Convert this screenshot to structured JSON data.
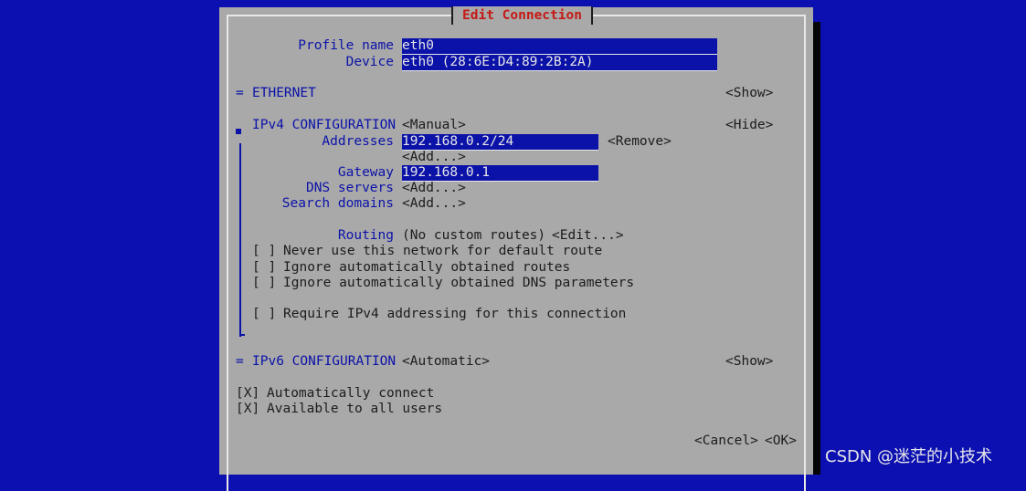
{
  "dialog": {
    "title": "Edit Connection",
    "profile_name_label": "Profile name",
    "profile_name_value": "eth0",
    "device_label": "Device",
    "device_value": "eth0 (28:6E:D4:89:2B:2A)"
  },
  "ethernet": {
    "marker": "=",
    "label": "ETHERNET",
    "toggle": "<Show>"
  },
  "ipv4": {
    "label": "IPv4 CONFIGURATION",
    "mode": "<Manual>",
    "toggle": "<Hide>",
    "addresses_label": "Addresses",
    "address_value": "192.168.0.2/24",
    "remove_button": "<Remove>",
    "add_address_button": "<Add...>",
    "gateway_label": "Gateway",
    "gateway_value": "192.168.0.1",
    "dns_label": "DNS servers",
    "dns_add_button": "<Add...>",
    "search_label": "Search domains",
    "search_add_button": "<Add...>",
    "routing_label": "Routing",
    "routing_value": "(No custom routes)",
    "routing_edit_button": "<Edit...>",
    "checkboxes": [
      {
        "box": "[ ]",
        "label": "Never use this network for default route"
      },
      {
        "box": "[ ]",
        "label": "Ignore automatically obtained routes"
      },
      {
        "box": "[ ]",
        "label": "Ignore automatically obtained DNS parameters"
      },
      {
        "box": "[ ]",
        "label": "Require IPv4 addressing for this connection"
      }
    ]
  },
  "ipv6": {
    "marker": "=",
    "label": "IPv6 CONFIGURATION",
    "mode": "<Automatic>",
    "toggle": "<Show>"
  },
  "options": [
    {
      "box": "[X]",
      "label": "Automatically connect"
    },
    {
      "box": "[X]",
      "label": "Available to all users"
    }
  ],
  "buttons": {
    "cancel": "<Cancel>",
    "ok": "<OK>"
  },
  "watermark": "CSDN @迷茫的小技术",
  "colors": {
    "background": "#0c10b0",
    "dialog": "#a9a9a9",
    "accent_blue": "#0b12a8",
    "title_red": "#c41a16"
  }
}
